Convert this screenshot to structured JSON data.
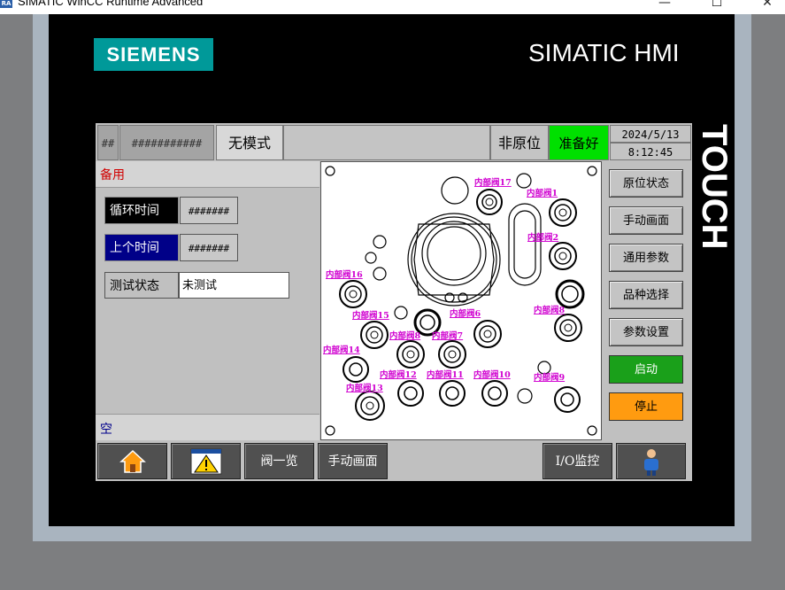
{
  "window": {
    "app_icon": "RA",
    "title": "SIMATIC WinCC Runtime Advanced",
    "minimize": "—",
    "maximize": "☐",
    "close": "✕"
  },
  "bezel": {
    "brand": "SIEMENS",
    "model": "SIMATIC HMI",
    "touch": "TOUCH"
  },
  "header": {
    "hash_short": "##",
    "hash_long": "###########",
    "mode": "无模式",
    "non_origin": "非原位",
    "ready": "准备好",
    "date": "2024/5/13",
    "time": "8:12:45",
    "colors": {
      "ready_bg": "#00e000"
    }
  },
  "left": {
    "spare": "备用",
    "cycle_time_label": "循环时间",
    "cycle_time_value": "#######",
    "last_time_label": "上个时间",
    "last_time_value": "#######",
    "test_state_label": "测试状态",
    "test_state_value": "未测试",
    "empty": "空"
  },
  "diagram": {
    "valves": [
      "内部阀17",
      "内部阀1",
      "内部阀2",
      "内部阀16",
      "内部阀8",
      "内部阀15",
      "内部阀6",
      "内部阀8",
      "内部阀7",
      "内部阀14",
      "内部阀12",
      "内部阀11",
      "内部阀10",
      "内部阀9",
      "内部阀13"
    ]
  },
  "side_buttons": [
    "原位状态",
    "手动画面",
    "通用参数",
    "品种选择",
    "参数设置"
  ],
  "start": "启动",
  "stop": "停止",
  "footer": {
    "home_icon": "home-icon",
    "alarm_icon": "warning-icon",
    "valve_list": "阀一览",
    "manual": "手动画面",
    "io_monitor": "I/O监控",
    "user_icon": "user-icon"
  }
}
